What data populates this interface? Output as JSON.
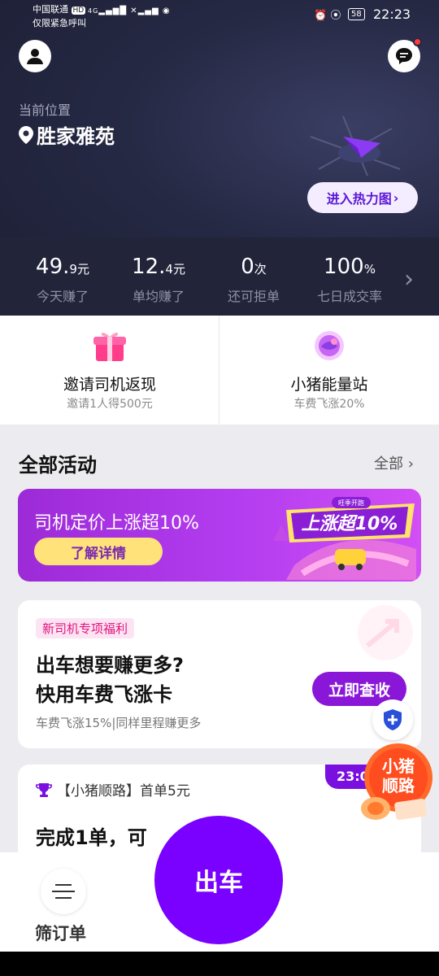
{
  "status_bar": {
    "carrier_line1": "中国联通",
    "carrier_hd": "HD",
    "carrier_line2": "仅限紧急呼叫",
    "network": "4G",
    "battery": "58",
    "time": "22:23"
  },
  "location": {
    "label": "当前位置",
    "name": "胜家雅苑"
  },
  "heatmap_button": "进入热力图",
  "stats": [
    {
      "value": "49.",
      "decimal": "9",
      "unit": "元",
      "label": "今天赚了"
    },
    {
      "value": "12.",
      "decimal": "4",
      "unit": "元",
      "label": "单均赚了"
    },
    {
      "value": "0",
      "decimal": "",
      "unit": "次",
      "label": "还可拒单"
    },
    {
      "value": "100",
      "decimal": "",
      "unit": "%",
      "label": "七日成交率"
    }
  ],
  "quick_cards": [
    {
      "title": "邀请司机返现",
      "subtitle": "邀请1人得500元"
    },
    {
      "title": "小猪能量站",
      "subtitle": "车费飞涨20%"
    }
  ],
  "activities": {
    "title": "全部活动",
    "all_link": "全部"
  },
  "banner": {
    "title": "司机定价上涨超10%",
    "button": "了解详情",
    "badge_small": "旺季开跑",
    "badge_big": "上涨超10%"
  },
  "welfare_card": {
    "tag": "新司机专项福利",
    "headline1": "出车想要赚更多?",
    "headline2": "快用车费飞涨卡",
    "subtitle": "车费飞涨15%|同样里程赚更多",
    "button": "立即查收"
  },
  "promo_card": {
    "title": "【小猪顺路】首单5元",
    "time_badge": "23:00",
    "main_text": "完成1单，可"
  },
  "floating_badge": {
    "line1": "小猪",
    "line2": "顺路"
  },
  "bottom": {
    "filter_label": "筛订单",
    "go_button": "出车"
  },
  "colors": {
    "accent": "#7a00ff",
    "hero_bg": "#262944",
    "banner": "#b33df0"
  }
}
